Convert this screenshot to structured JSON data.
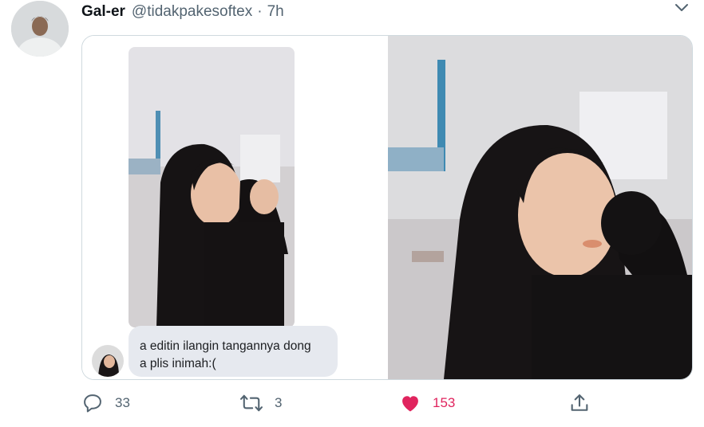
{
  "tweet": {
    "display_name": "Gal-er",
    "handle": "@tidakpakesoftex",
    "separator": "·",
    "time": "7h"
  },
  "media": {
    "chat_message_line1": "a editin ilangin tangannya dong",
    "chat_message_line2": "a plis inimah:("
  },
  "actions": {
    "reply_count": "33",
    "retweet_count": "3",
    "like_count": "153",
    "like_active": true
  },
  "colors": {
    "like": "#e0245e",
    "muted": "#536471",
    "border": "#cfd9de",
    "chat_bubble": "#e6e9ef"
  },
  "icons": {
    "reply": "reply-icon",
    "retweet": "retweet-icon",
    "like": "heart-icon",
    "share": "share-icon",
    "more": "chevron-down-icon"
  }
}
